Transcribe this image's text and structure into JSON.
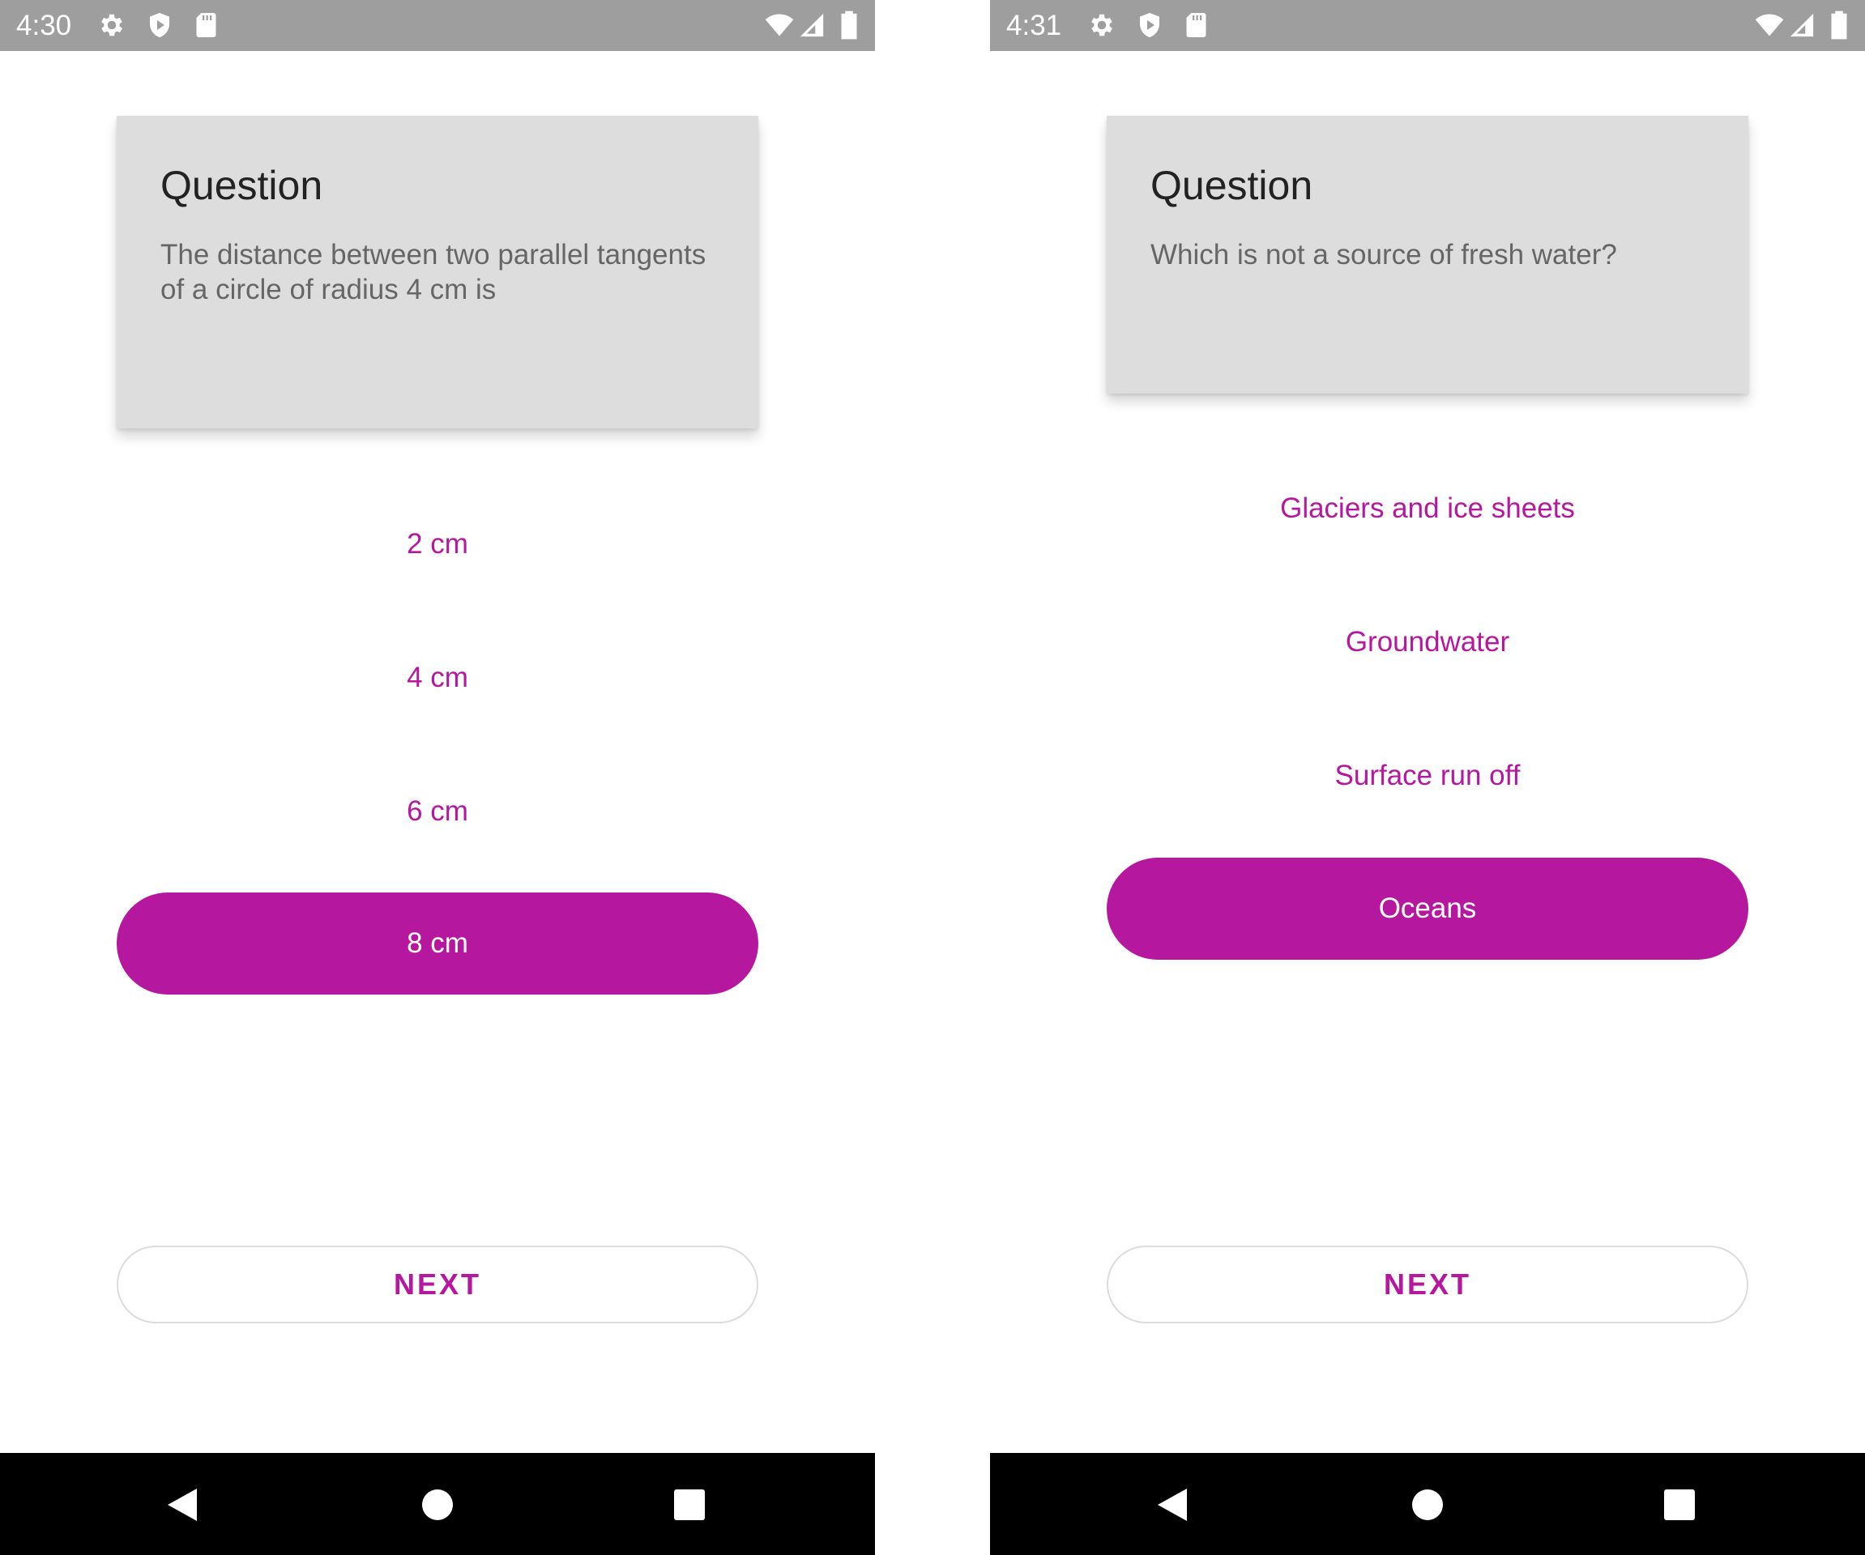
{
  "screens": [
    {
      "status_time": "4:30",
      "question_title": "Question",
      "question_text": "The distance between two parallel tangents of a circle of radius 4 cm is",
      "answers": [
        "2 cm",
        "4 cm",
        "6 cm",
        "8 cm"
      ],
      "selected_answer": "8 cm",
      "next_label": "NEXT"
    },
    {
      "status_time": "4:31",
      "question_title": "Question",
      "question_text": "Which is not a source of fresh water?",
      "answers": [
        "Glaciers and ice sheets",
        "Groundwater",
        "Surface run off",
        "Oceans"
      ],
      "selected_answer": "Oceans",
      "next_label": "NEXT"
    }
  ],
  "status_icons": [
    "gear-icon",
    "shield-icon",
    "sd-card-icon"
  ],
  "status_right_icons": [
    "wifi-icon",
    "signal-icon",
    "battery-icon"
  ],
  "nav_icons": [
    "back-icon",
    "home-icon",
    "recents-icon"
  ],
  "colors": {
    "accent": "#b5179e",
    "card_background": "#dddddd",
    "status_bar": "#9e9e9e",
    "nav_bar": "#000000"
  }
}
